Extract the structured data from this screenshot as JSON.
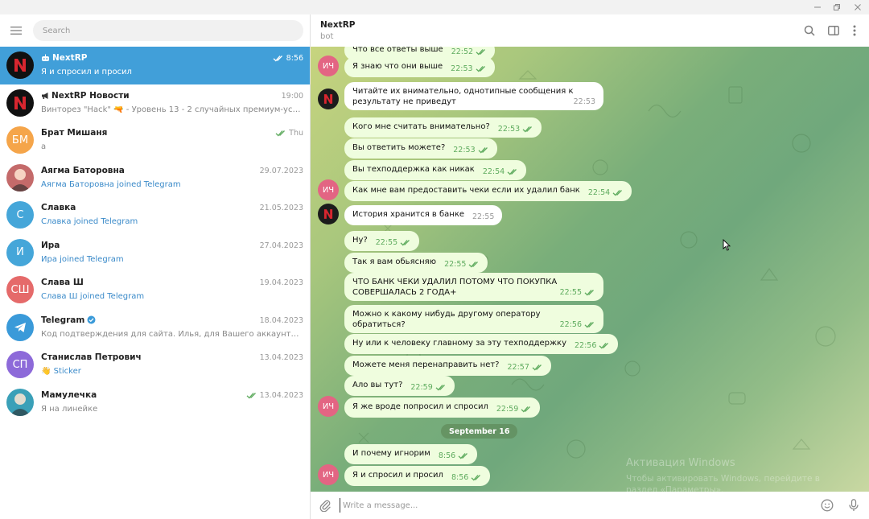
{
  "colors": {
    "accent": "#419fd9",
    "outgoing_bubble": "#effdde",
    "read_check": "#5eab5e"
  },
  "search": {
    "placeholder": "Search"
  },
  "chats": [
    {
      "name": "NextRP",
      "name_icon": "bot-icon",
      "date": "8:56",
      "read": true,
      "preview": "Я и спросил и просил",
      "avatar": "N",
      "avatar_color": "#111111",
      "active": true
    },
    {
      "name": "NextRP Новости",
      "name_icon": "megaphone-icon",
      "date": "19:00",
      "preview": "Винторез \"Hack\" 🔫 - Уровень 13 - 2 случайных премиум-усилен...",
      "avatar": "N",
      "avatar_color": "#111111"
    },
    {
      "name": "Брат Мишаня",
      "date": "Thu",
      "read": true,
      "preview": "а",
      "avatar": "БМ",
      "avatar_color": "#f5a54a"
    },
    {
      "name": "Аягма Баторовна",
      "date": "29.07.2023",
      "preview": "Аягма Баторовна joined Telegram",
      "preview_link": true,
      "avatar": "",
      "avatar_color": "#c46a6a"
    },
    {
      "name": "Славка",
      "date": "21.05.2023",
      "preview": "Славка joined Telegram",
      "preview_link": true,
      "avatar": "С",
      "avatar_color": "#45a6d9"
    },
    {
      "name": "Ира",
      "date": "27.04.2023",
      "preview": "Ира joined Telegram",
      "preview_link": true,
      "avatar": "И",
      "avatar_color": "#45a6d9"
    },
    {
      "name": "Слава Ш",
      "date": "19.04.2023",
      "preview": "Слава Ш joined Telegram",
      "preview_link": true,
      "avatar": "СШ",
      "avatar_color": "#e56a6a"
    },
    {
      "name": "Telegram",
      "verified": true,
      "date": "18.04.2023",
      "preview": "Код подтверждения для сайта. Илья, для Вашего аккаунта запросил...",
      "avatar": "",
      "avatar_color": "#3a9ad9"
    },
    {
      "name": "Станислав Петрович",
      "date": "13.04.2023",
      "preview": "👋 Sticker",
      "preview_link": true,
      "avatar": "СП",
      "avatar_color": "#8d6ad9"
    },
    {
      "name": "Мамулечка",
      "date": "13.04.2023",
      "read": true,
      "preview": "Я на линейке",
      "avatar": "",
      "avatar_color": "#3aa0b8"
    }
  ],
  "header": {
    "title": "NextRP",
    "subtitle": "bot"
  },
  "messages": [
    {
      "dir": "out",
      "text": "Что все ответы выше",
      "time": "22:52"
    },
    {
      "dir": "out",
      "text": "Я знаю что они выше",
      "time": "22:53",
      "avatar": "ИЧ"
    },
    {
      "dir": "in",
      "text": "Читайте их внимательно, однотипные сообщения к результату не приведут",
      "time": "22:53",
      "avatar": "N"
    },
    {
      "dir": "out",
      "text": "Кого мне считать внимательно?",
      "time": "22:53"
    },
    {
      "dir": "out",
      "text": "Вы ответить можете?",
      "time": "22:53"
    },
    {
      "dir": "out",
      "text": "Вы техподдержка как никак",
      "time": "22:54"
    },
    {
      "dir": "out",
      "text": "Как мне вам предоставить чеки если их удалил банк",
      "time": "22:54",
      "avatar": "ИЧ"
    },
    {
      "dir": "in",
      "text": "История хранится в банке",
      "time": "22:55",
      "avatar": "N"
    },
    {
      "dir": "out",
      "text": "Ну?",
      "time": "22:55"
    },
    {
      "dir": "out",
      "text": "Так я вам обьясняю",
      "time": "22:55"
    },
    {
      "dir": "out",
      "text": "ЧТО БАНК ЧЕКИ УДАЛИЛ ПОТОМУ ЧТО ПОКУПКА СОВЕРШАЛАСЬ 2 ГОДА+",
      "time": "22:55"
    },
    {
      "dir": "out",
      "text": "Можно к какому нибудь другому оператору обратиться?",
      "time": "22:56"
    },
    {
      "dir": "out",
      "text": "Ну или к человеку главному за эту техподдержку",
      "time": "22:56"
    },
    {
      "dir": "out",
      "text": "Можете меня перенаправить нет?",
      "time": "22:57"
    },
    {
      "dir": "out",
      "text": "Ало вы тут?",
      "time": "22:59"
    },
    {
      "dir": "out",
      "text": "Я же вроде попросил и спросил",
      "time": "22:59",
      "avatar": "ИЧ"
    },
    {
      "dir": "out",
      "text": "И почему игнорим",
      "time": "8:56"
    },
    {
      "dir": "out",
      "text": "Я и спросил и просил",
      "time": "8:56",
      "avatar": "ИЧ"
    }
  ],
  "date_separator": "September 16",
  "watermark": {
    "line1": "Активация Windows",
    "line2": "Чтобы активировать Windows, перейдите в раздел «Параметры»."
  },
  "composer": {
    "placeholder": "Write a message..."
  }
}
